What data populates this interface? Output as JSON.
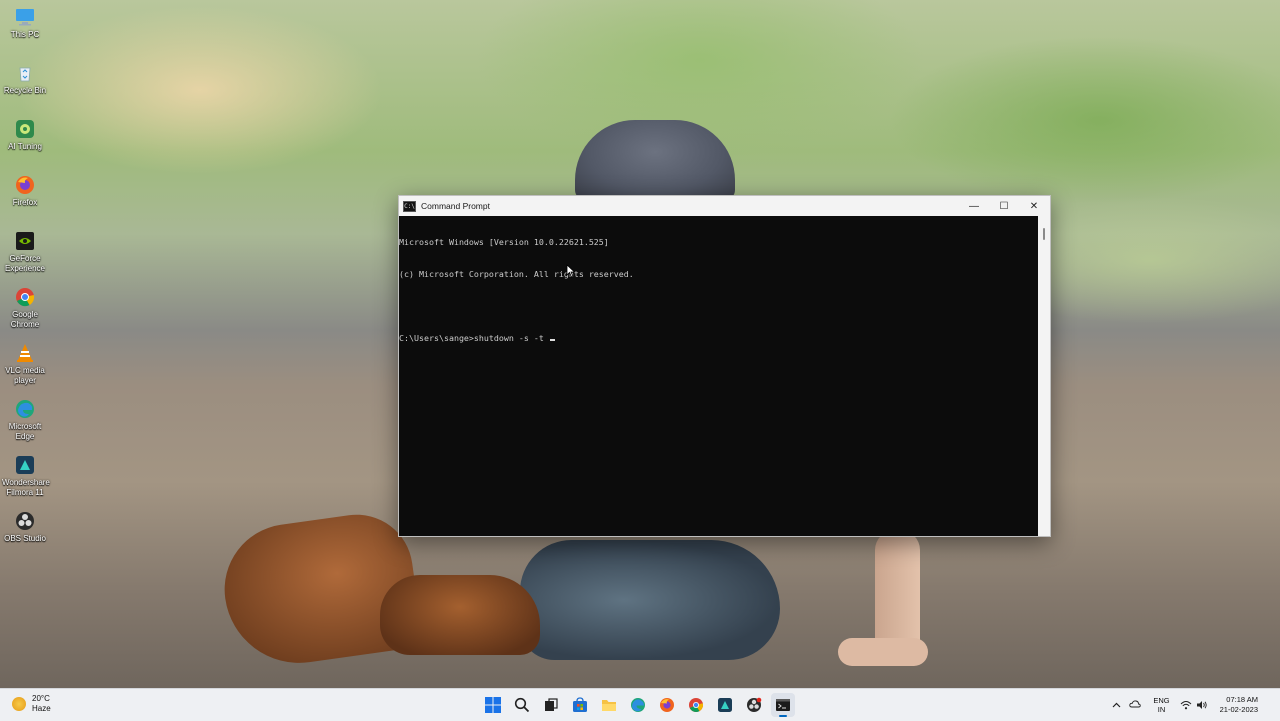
{
  "desktop": {
    "icons": [
      {
        "label": "This PC",
        "icon": "monitor-icon",
        "color": "#3aa0e8"
      },
      {
        "label": "Recycle Bin",
        "icon": "recycle-bin-icon",
        "color": "#e8eef5"
      },
      {
        "label": "AI Tuning",
        "icon": "ai-tuning-icon",
        "color": "#2f8a4c"
      },
      {
        "label": "Firefox",
        "icon": "firefox-icon",
        "color": "#f0641e"
      },
      {
        "label": "GeForce Experience",
        "icon": "geforce-icon",
        "color": "#76b900"
      },
      {
        "label": "Google Chrome",
        "icon": "chrome-icon",
        "color": "#db4437"
      },
      {
        "label": "VLC media player",
        "icon": "vlc-icon",
        "color": "#f08a00"
      },
      {
        "label": "Microsoft Edge",
        "icon": "edge-icon",
        "color": "#1fa67a"
      },
      {
        "label": "Wondershare Filmora 11",
        "icon": "filmora-icon",
        "color": "#1b3d57"
      },
      {
        "label": "OBS Studio",
        "icon": "obs-icon",
        "color": "#2b2b2b"
      }
    ]
  },
  "window": {
    "title": "Command Prompt",
    "minimize": "—",
    "maximize": "☐",
    "close": "✕",
    "console_lines": [
      "Microsoft Windows [Version 10.0.22621.525]",
      "(c) Microsoft Corporation. All rights reserved.",
      "",
      "C:\\Users\\sange>shutdown -s -t "
    ]
  },
  "taskbar": {
    "weather_temp": "20°C",
    "weather_desc": "Haze",
    "pinned": [
      {
        "name": "start-button",
        "icon": "windows-logo-icon"
      },
      {
        "name": "search-button",
        "icon": "search-icon"
      },
      {
        "name": "task-view-button",
        "icon": "task-view-icon"
      },
      {
        "name": "store-button",
        "icon": "store-icon"
      },
      {
        "name": "file-explorer-button",
        "icon": "folder-icon"
      },
      {
        "name": "edge-button",
        "icon": "edge-icon"
      },
      {
        "name": "firefox-button",
        "icon": "firefox-icon"
      },
      {
        "name": "chrome-button",
        "icon": "chrome-icon"
      },
      {
        "name": "filmora-button",
        "icon": "filmora-icon"
      },
      {
        "name": "obs-button",
        "icon": "obs-icon"
      },
      {
        "name": "terminal-button",
        "icon": "terminal-icon"
      }
    ],
    "lang_line1": "ENG",
    "lang_line2": "IN",
    "time": "07:18 AM",
    "date": "21-02-2023"
  }
}
